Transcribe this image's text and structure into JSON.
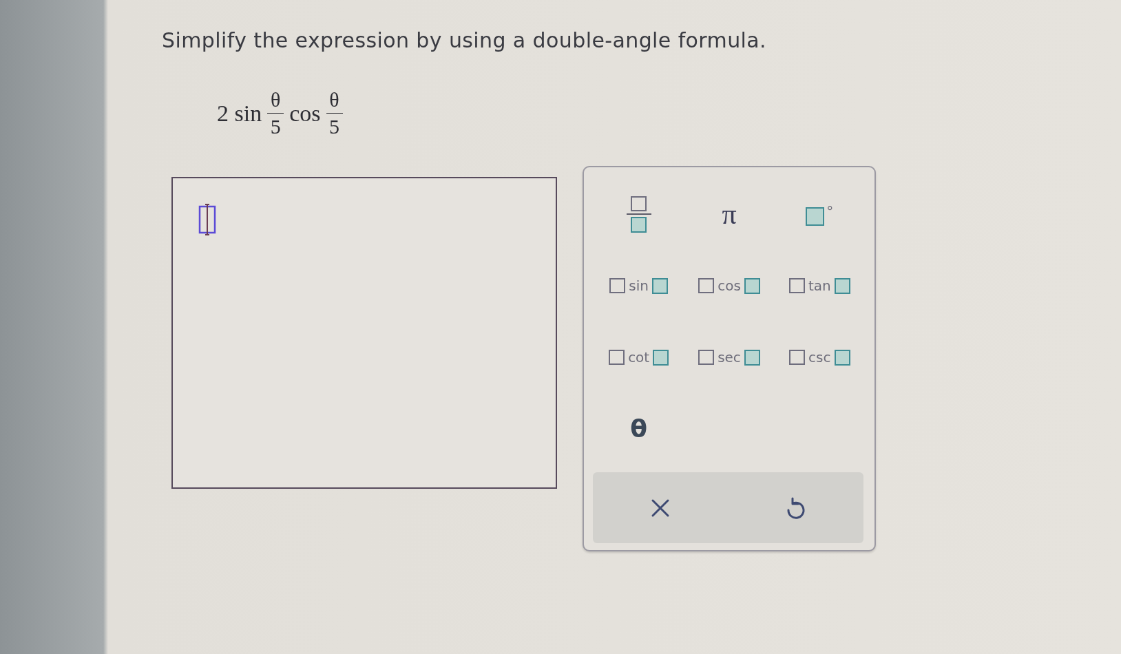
{
  "question": {
    "prompt": "Simplify the expression by using a double-angle formula.",
    "expression": [
      {
        "kind": "text",
        "text": "2 sin"
      },
      {
        "kind": "fraction",
        "numerator": "θ",
        "denominator": "5"
      },
      {
        "kind": "text",
        "text": "cos"
      },
      {
        "kind": "fraction",
        "numerator": "θ",
        "denominator": "5"
      }
    ]
  },
  "answer_box": {
    "focused": true
  },
  "keypad": {
    "keys": [
      {
        "kind": "fraction"
      },
      {
        "kind": "constant",
        "label": "π"
      },
      {
        "kind": "degree",
        "label": "°"
      },
      {
        "kind": "function",
        "label": "sin"
      },
      {
        "kind": "function",
        "label": "cos"
      },
      {
        "kind": "function",
        "label": "tan"
      },
      {
        "kind": "function",
        "label": "cot"
      },
      {
        "kind": "function",
        "label": "sec"
      },
      {
        "kind": "function",
        "label": "csc"
      },
      {
        "kind": "variable",
        "label": "θ"
      }
    ],
    "actions": [
      {
        "kind": "clear"
      },
      {
        "kind": "undo"
      }
    ]
  }
}
